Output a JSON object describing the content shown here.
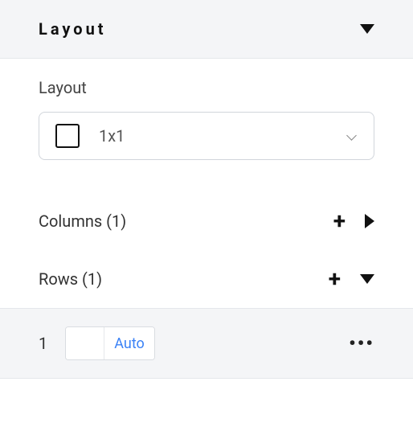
{
  "header": {
    "title": "Layout"
  },
  "section": {
    "layout_label": "Layout",
    "layout_select": {
      "value": "1x1"
    },
    "columns": {
      "label": "Columns (1)",
      "count": 1
    },
    "rows": {
      "label": "Rows (1)",
      "count": 1,
      "items": [
        {
          "index": "1",
          "size": "Auto"
        }
      ]
    }
  }
}
